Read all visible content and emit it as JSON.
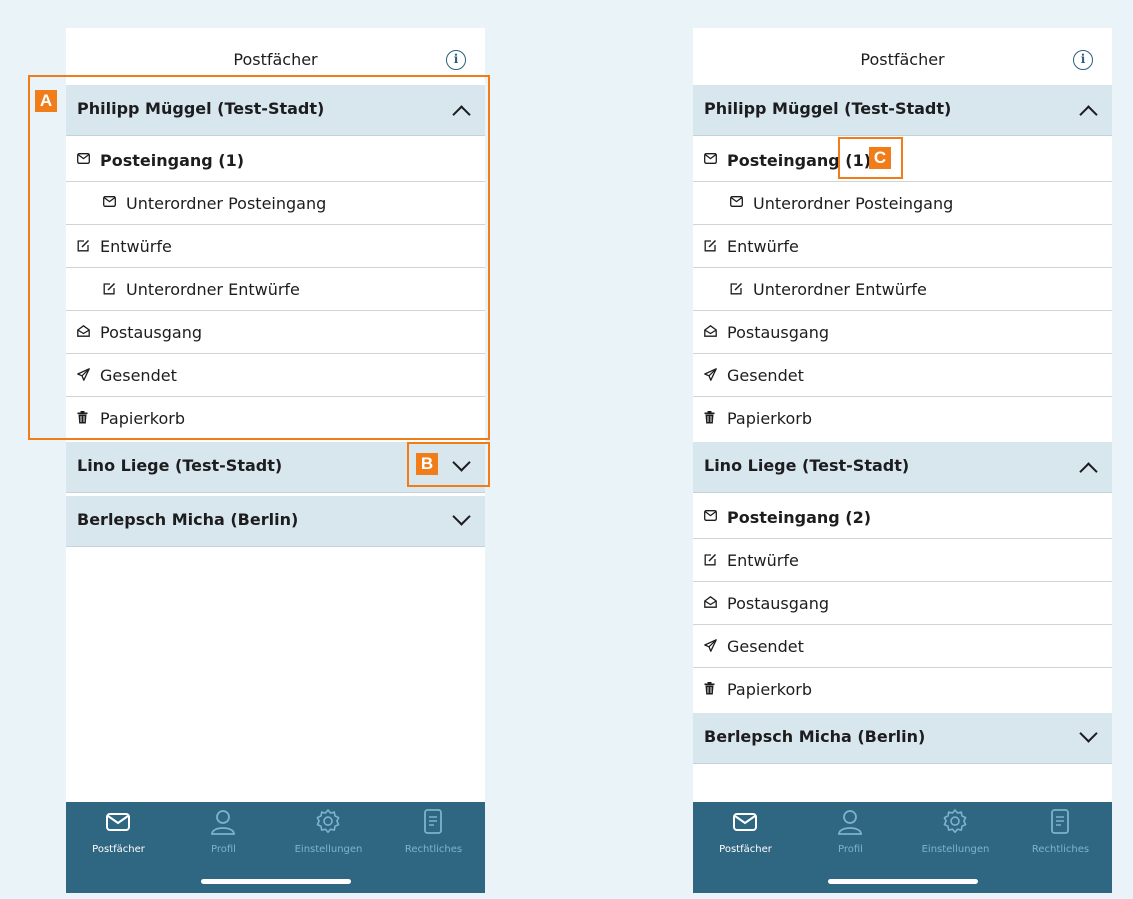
{
  "screens": [
    {
      "title": "Postfächer",
      "accounts": [
        {
          "name": "Philipp Müggel (Test-Stadt)",
          "expanded": true,
          "folders": [
            {
              "label": "Posteingang (1)",
              "icon": "mail-icon",
              "indent": false,
              "bold": true
            },
            {
              "label": "Unterordner Posteingang",
              "icon": "mail-icon",
              "indent": true,
              "bold": false
            },
            {
              "label": "Entwürfe",
              "icon": "edit-icon",
              "indent": false,
              "bold": false
            },
            {
              "label": "Unterordner Entwürfe",
              "icon": "edit-icon",
              "indent": true,
              "bold": false
            },
            {
              "label": "Postausgang",
              "icon": "outbox-icon",
              "indent": false,
              "bold": false
            },
            {
              "label": "Gesendet",
              "icon": "send-icon",
              "indent": false,
              "bold": false
            },
            {
              "label": "Papierkorb",
              "icon": "trash-icon",
              "indent": false,
              "bold": false
            }
          ]
        },
        {
          "name": "Lino Liege (Test-Stadt)",
          "expanded": false,
          "folders": []
        },
        {
          "name": "Berlepsch Micha (Berlin)",
          "expanded": false,
          "folders": []
        }
      ]
    },
    {
      "title": "Postfächer",
      "accounts": [
        {
          "name": "Philipp Müggel (Test-Stadt)",
          "expanded": true,
          "folders": [
            {
              "label": "Posteingang (1)",
              "icon": "mail-icon",
              "indent": false,
              "bold": true
            },
            {
              "label": "Unterordner Posteingang",
              "icon": "mail-icon",
              "indent": true,
              "bold": false
            },
            {
              "label": "Entwürfe",
              "icon": "edit-icon",
              "indent": false,
              "bold": false
            },
            {
              "label": "Unterordner Entwürfe",
              "icon": "edit-icon",
              "indent": true,
              "bold": false
            },
            {
              "label": "Postausgang",
              "icon": "outbox-icon",
              "indent": false,
              "bold": false
            },
            {
              "label": "Gesendet",
              "icon": "send-icon",
              "indent": false,
              "bold": false
            },
            {
              "label": "Papierkorb",
              "icon": "trash-icon",
              "indent": false,
              "bold": false
            }
          ]
        },
        {
          "name": "Lino Liege (Test-Stadt)",
          "expanded": true,
          "folders": [
            {
              "label": "Posteingang (2)",
              "icon": "mail-icon",
              "indent": false,
              "bold": true
            },
            {
              "label": "Entwürfe",
              "icon": "edit-icon",
              "indent": false,
              "bold": false
            },
            {
              "label": "Postausgang",
              "icon": "outbox-icon",
              "indent": false,
              "bold": false
            },
            {
              "label": "Gesendet",
              "icon": "send-icon",
              "indent": false,
              "bold": false
            },
            {
              "label": "Papierkorb",
              "icon": "trash-icon",
              "indent": false,
              "bold": false
            }
          ]
        },
        {
          "name": "Berlepsch Micha (Berlin)",
          "expanded": false,
          "folders": []
        }
      ]
    }
  ],
  "tabbar": {
    "tabs": [
      {
        "label": "Postfächer",
        "icon": "mail-icon",
        "active": true
      },
      {
        "label": "Profil",
        "icon": "person-icon",
        "active": false
      },
      {
        "label": "Einstellungen",
        "icon": "gear-icon",
        "active": false
      },
      {
        "label": "Rechtliches",
        "icon": "document-icon",
        "active": false
      }
    ]
  },
  "callouts": {
    "a": "A",
    "b": "B",
    "c": "C"
  },
  "colors": {
    "accent": "#f07d1a",
    "account_header_bg": "#d8e6ee",
    "tabbar_bg": "#2f6783",
    "page_bg": "#eaf3f7"
  }
}
